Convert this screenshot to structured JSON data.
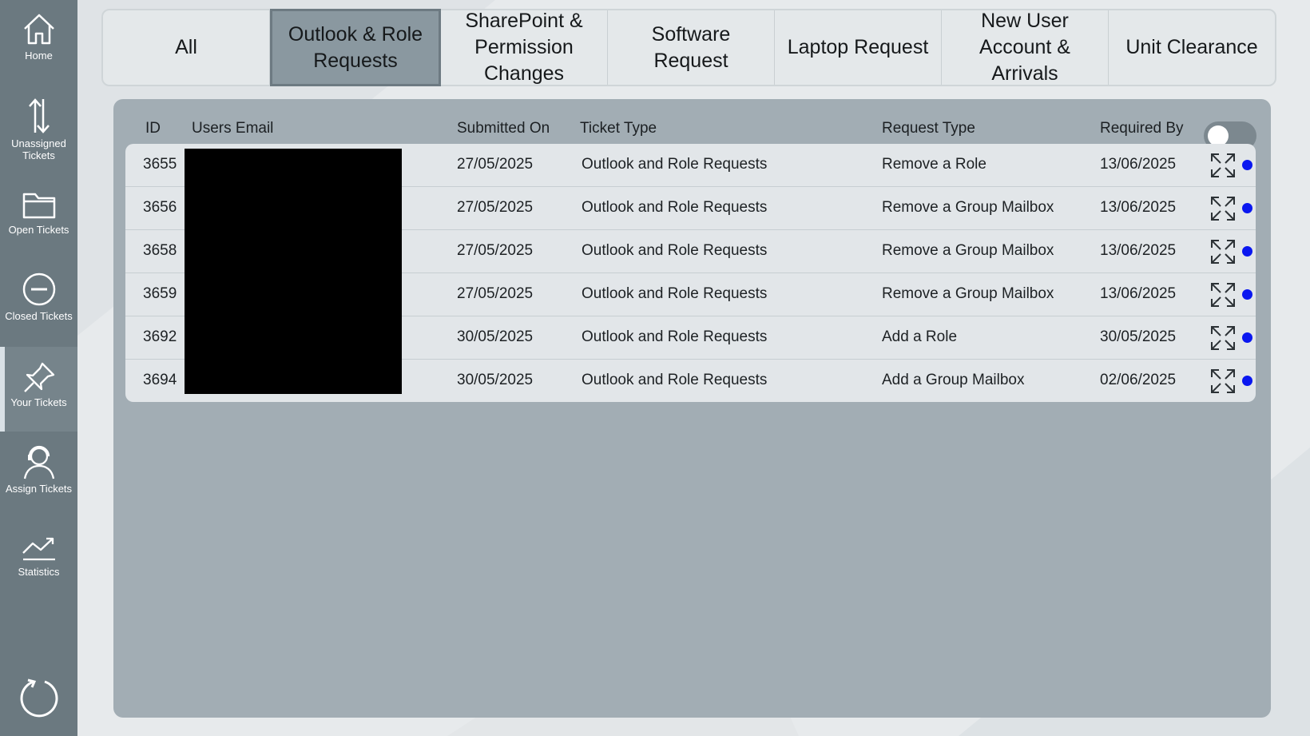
{
  "colors": {
    "sidebar": "#6b7980",
    "panel": "#a2adb4",
    "active_tab": "#8a98a0",
    "status_dot": "#0a17f0"
  },
  "sidebar": {
    "items": [
      {
        "label": "Home",
        "icon": "home-icon"
      },
      {
        "label": "Unassigned Tickets",
        "icon": "sort-arrows-icon"
      },
      {
        "label": "Open Tickets",
        "icon": "folder-icon"
      },
      {
        "label": "Closed Tickets",
        "icon": "minus-circle-icon"
      },
      {
        "label": "Your Tickets",
        "icon": "pin-icon"
      },
      {
        "label": "Assign Tickets",
        "icon": "headset-user-icon"
      },
      {
        "label": "Statistics",
        "icon": "trend-chart-icon"
      }
    ],
    "active": "Your Tickets",
    "refresh_icon": "refresh-icon"
  },
  "tabs": [
    {
      "label": "All"
    },
    {
      "label": "Outlook & Role Requests",
      "active": true
    },
    {
      "label": "SharePoint & Permission Changes"
    },
    {
      "label": "Software Request"
    },
    {
      "label": "Laptop Request"
    },
    {
      "label": "New User Account & Arrivals"
    },
    {
      "label": "Unit Clearance"
    }
  ],
  "table": {
    "headers": {
      "id": "ID",
      "email": "Users Email",
      "submitted": "Submitted On",
      "ticket_type": "Ticket Type",
      "request_type": "Request Type",
      "required_by": "Required By"
    },
    "toggle_on": false,
    "rows": [
      {
        "id": "3655",
        "submitted": "27/05/2025",
        "ticket_type": "Outlook and Role Requests",
        "request_type": "Remove a Role",
        "required_by": "13/06/2025"
      },
      {
        "id": "3656",
        "submitted": "27/05/2025",
        "ticket_type": "Outlook and Role Requests",
        "request_type": "Remove a Group Mailbox",
        "required_by": "13/06/2025"
      },
      {
        "id": "3658",
        "submitted": "27/05/2025",
        "ticket_type": "Outlook and Role Requests",
        "request_type": "Remove a Group Mailbox",
        "required_by": "13/06/2025"
      },
      {
        "id": "3659",
        "submitted": "27/05/2025",
        "ticket_type": "Outlook and Role Requests",
        "request_type": "Remove a Group Mailbox",
        "required_by": "13/06/2025"
      },
      {
        "id": "3692",
        "submitted": "30/05/2025",
        "ticket_type": "Outlook and Role Requests",
        "request_type": "Add a Role",
        "required_by": "30/05/2025"
      },
      {
        "id": "3694",
        "submitted": "30/05/2025",
        "ticket_type": "Outlook and Role Requests",
        "request_type": "Add a Group Mailbox",
        "required_by": "02/06/2025"
      }
    ]
  }
}
